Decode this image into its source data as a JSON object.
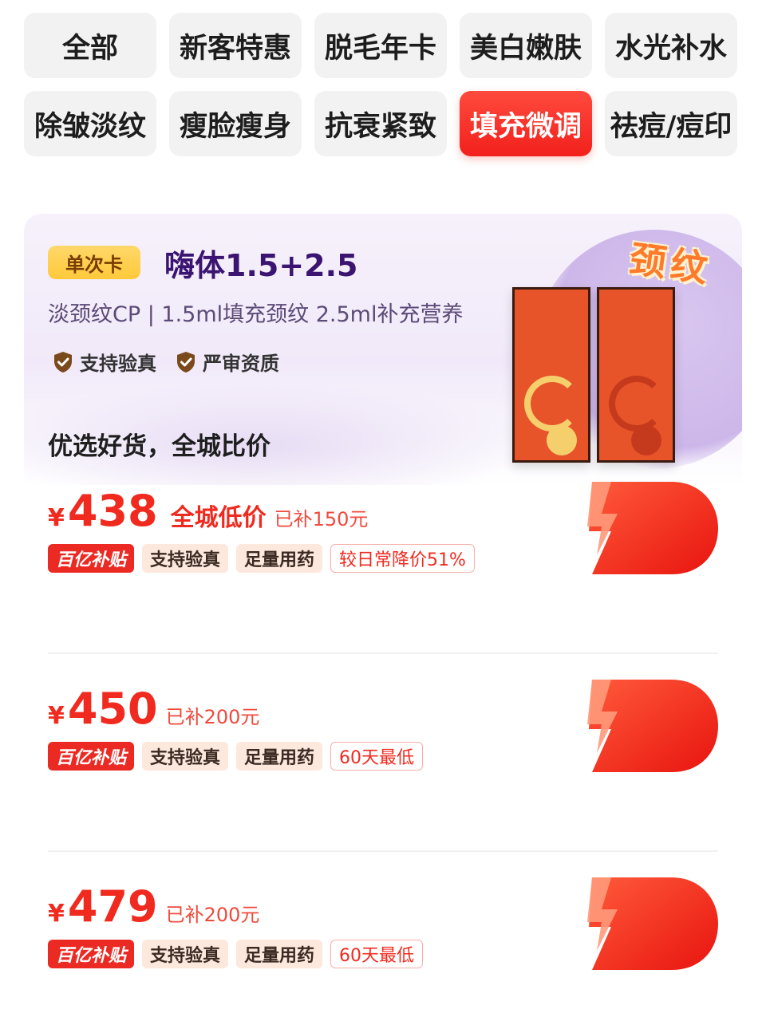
{
  "categories": [
    {
      "label": "全部",
      "active": false
    },
    {
      "label": "新客特惠",
      "active": false
    },
    {
      "label": "脱毛年卡",
      "active": false
    },
    {
      "label": "美白嫩肤",
      "active": false
    },
    {
      "label": "水光补水",
      "active": false
    },
    {
      "label": "除皱淡纹",
      "active": false
    },
    {
      "label": "瘦脸瘦身",
      "active": false
    },
    {
      "label": "抗衰紧致",
      "active": false
    },
    {
      "label": "填充微调",
      "active": true
    },
    {
      "label": "祛痘/痘印",
      "active": false
    }
  ],
  "product": {
    "card_tag": "单次卡",
    "title": "嗨体1.5+2.5",
    "description": "淡颈纹CP | 1.5ml填充颈纹 2.5ml补充营养",
    "badges": [
      "支持验真",
      "严审资质"
    ],
    "image_label": "颈纹",
    "slogan": "优选好货，全城比价"
  },
  "offers": [
    {
      "currency": "¥",
      "price": "438",
      "low_tag": "全城低价",
      "subsidy": "已补150元",
      "tags": {
        "brand": "百亿补贴",
        "t1": "支持验真",
        "t2": "足量用药",
        "t3": "较日常降价51%"
      }
    },
    {
      "currency": "¥",
      "price": "450",
      "low_tag": "",
      "subsidy": "已补200元",
      "tags": {
        "brand": "百亿补贴",
        "t1": "支持验真",
        "t2": "足量用药",
        "t3": "60天最低"
      }
    },
    {
      "currency": "¥",
      "price": "479",
      "low_tag": "",
      "subsidy": "已补200元",
      "tags": {
        "brand": "百亿补贴",
        "t1": "支持验真",
        "t2": "足量用药",
        "t3": "60天最低"
      }
    }
  ],
  "colors": {
    "accent": "#f02a1f",
    "card_tag": "#ffc93a",
    "title": "#3a1470"
  },
  "icons": {
    "badge": "shield-check-icon",
    "buy": "lightning-d-logo-icon"
  }
}
